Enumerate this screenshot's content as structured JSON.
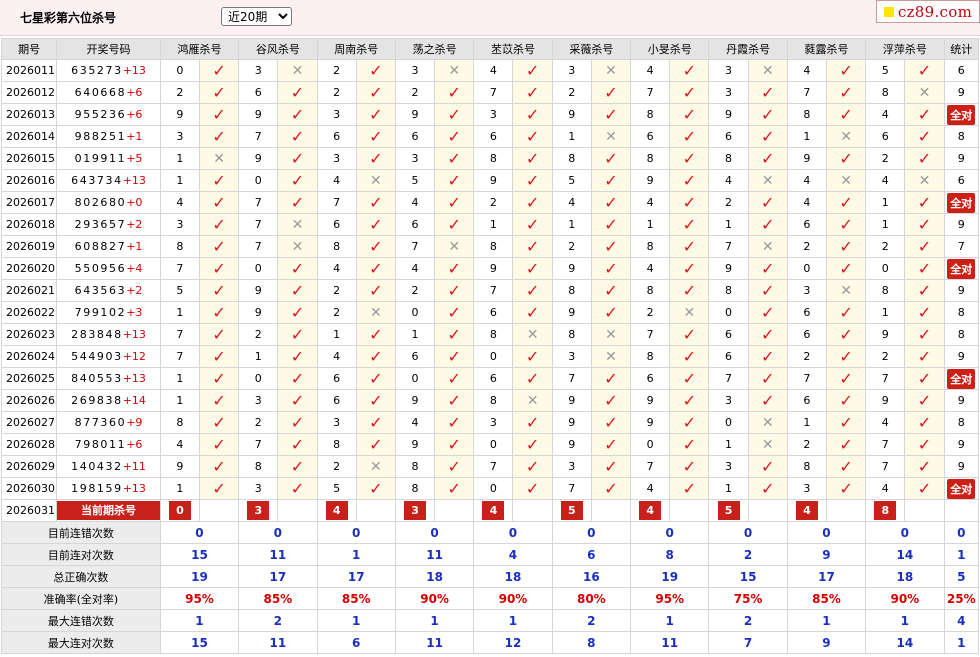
{
  "header": {
    "title": "七星彩第六位杀号",
    "period_select": "近20期",
    "logo_text": "cz89.com"
  },
  "columns": [
    "期号",
    "开奖号码",
    "鸿雁杀号",
    "谷风杀号",
    "周南杀号",
    "荡之杀号",
    "苤苡杀号",
    "采薇杀号",
    "小旻杀号",
    "丹霞杀号",
    "蕤露杀号",
    "浮萍杀号",
    "统计"
  ],
  "rows": [
    {
      "p": "2026011",
      "d": "635273",
      "x": "+13",
      "k": [
        "0",
        "3",
        "2",
        "3",
        "4",
        "3",
        "4",
        "3",
        "4",
        "5"
      ],
      "r": [
        1,
        0,
        1,
        0,
        1,
        0,
        1,
        0,
        1,
        1
      ],
      "t": "6"
    },
    {
      "p": "2026012",
      "d": "640668",
      "x": "+6",
      "k": [
        "2",
        "6",
        "2",
        "2",
        "7",
        "2",
        "7",
        "3",
        "7",
        "8"
      ],
      "r": [
        1,
        1,
        1,
        1,
        1,
        1,
        1,
        1,
        1,
        0
      ],
      "t": "9"
    },
    {
      "p": "2026013",
      "d": "955236",
      "x": "+6",
      "k": [
        "9",
        "9",
        "3",
        "9",
        "3",
        "9",
        "8",
        "9",
        "8",
        "4"
      ],
      "r": [
        1,
        1,
        1,
        1,
        1,
        1,
        1,
        1,
        1,
        1
      ],
      "t": "全对"
    },
    {
      "p": "2026014",
      "d": "988251",
      "x": "+1",
      "k": [
        "3",
        "7",
        "6",
        "6",
        "6",
        "1",
        "6",
        "6",
        "1",
        "6"
      ],
      "r": [
        1,
        1,
        1,
        1,
        1,
        0,
        1,
        1,
        0,
        1
      ],
      "t": "8"
    },
    {
      "p": "2026015",
      "d": "019911",
      "x": "+5",
      "k": [
        "1",
        "9",
        "3",
        "3",
        "8",
        "8",
        "8",
        "8",
        "9",
        "2"
      ],
      "r": [
        0,
        1,
        1,
        1,
        1,
        1,
        1,
        1,
        1,
        1
      ],
      "t": "9"
    },
    {
      "p": "2026016",
      "d": "643734",
      "x": "+13",
      "k": [
        "1",
        "0",
        "4",
        "5",
        "9",
        "5",
        "9",
        "4",
        "4",
        "4"
      ],
      "r": [
        1,
        1,
        0,
        1,
        1,
        1,
        1,
        0,
        0,
        0
      ],
      "t": "6"
    },
    {
      "p": "2026017",
      "d": "802680",
      "x": "+0",
      "k": [
        "4",
        "7",
        "7",
        "4",
        "2",
        "4",
        "4",
        "2",
        "4",
        "1"
      ],
      "r": [
        1,
        1,
        1,
        1,
        1,
        1,
        1,
        1,
        1,
        1
      ],
      "t": "全对"
    },
    {
      "p": "2026018",
      "d": "293657",
      "x": "+2",
      "k": [
        "3",
        "7",
        "6",
        "6",
        "1",
        "1",
        "1",
        "1",
        "6",
        "1"
      ],
      "r": [
        1,
        0,
        1,
        1,
        1,
        1,
        1,
        1,
        1,
        1
      ],
      "t": "9"
    },
    {
      "p": "2026019",
      "d": "608827",
      "x": "+1",
      "k": [
        "8",
        "7",
        "8",
        "7",
        "8",
        "2",
        "8",
        "7",
        "2",
        "2"
      ],
      "r": [
        1,
        0,
        1,
        0,
        1,
        1,
        1,
        0,
        1,
        1
      ],
      "t": "7"
    },
    {
      "p": "2026020",
      "d": "550956",
      "x": "+4",
      "k": [
        "7",
        "0",
        "4",
        "4",
        "9",
        "9",
        "4",
        "9",
        "0",
        "0"
      ],
      "r": [
        1,
        1,
        1,
        1,
        1,
        1,
        1,
        1,
        1,
        1
      ],
      "t": "全对"
    },
    {
      "p": "2026021",
      "d": "643563",
      "x": "+2",
      "k": [
        "5",
        "9",
        "2",
        "2",
        "7",
        "8",
        "8",
        "8",
        "3",
        "8"
      ],
      "r": [
        1,
        1,
        1,
        1,
        1,
        1,
        1,
        1,
        0,
        1
      ],
      "t": "9"
    },
    {
      "p": "2026022",
      "d": "799102",
      "x": "+3",
      "k": [
        "1",
        "9",
        "2",
        "0",
        "6",
        "9",
        "2",
        "0",
        "6",
        "1"
      ],
      "r": [
        1,
        1,
        0,
        1,
        1,
        1,
        0,
        1,
        1,
        1
      ],
      "t": "8"
    },
    {
      "p": "2026023",
      "d": "283848",
      "x": "+13",
      "k": [
        "7",
        "2",
        "1",
        "1",
        "8",
        "8",
        "7",
        "6",
        "6",
        "9"
      ],
      "r": [
        1,
        1,
        1,
        1,
        0,
        0,
        1,
        1,
        1,
        1
      ],
      "t": "8"
    },
    {
      "p": "2026024",
      "d": "544903",
      "x": "+12",
      "k": [
        "7",
        "1",
        "4",
        "6",
        "0",
        "3",
        "8",
        "6",
        "2",
        "2"
      ],
      "r": [
        1,
        1,
        1,
        1,
        1,
        0,
        1,
        1,
        1,
        1
      ],
      "t": "9"
    },
    {
      "p": "2026025",
      "d": "840553",
      "x": "+13",
      "k": [
        "1",
        "0",
        "6",
        "0",
        "6",
        "7",
        "6",
        "7",
        "7",
        "7"
      ],
      "r": [
        1,
        1,
        1,
        1,
        1,
        1,
        1,
        1,
        1,
        1
      ],
      "t": "全对"
    },
    {
      "p": "2026026",
      "d": "269838",
      "x": "+14",
      "k": [
        "1",
        "3",
        "6",
        "9",
        "8",
        "9",
        "9",
        "3",
        "6",
        "9"
      ],
      "r": [
        1,
        1,
        1,
        1,
        0,
        1,
        1,
        1,
        1,
        1
      ],
      "t": "9"
    },
    {
      "p": "2026027",
      "d": "877360",
      "x": "+9",
      "k": [
        "8",
        "2",
        "3",
        "4",
        "3",
        "9",
        "9",
        "0",
        "1",
        "4"
      ],
      "r": [
        1,
        1,
        1,
        1,
        1,
        1,
        1,
        0,
        1,
        1
      ],
      "t": "8"
    },
    {
      "p": "2026028",
      "d": "798011",
      "x": "+6",
      "k": [
        "4",
        "7",
        "8",
        "9",
        "0",
        "9",
        "0",
        "1",
        "2",
        "7"
      ],
      "r": [
        1,
        1,
        1,
        1,
        1,
        1,
        1,
        0,
        1,
        1
      ],
      "t": "9"
    },
    {
      "p": "2026029",
      "d": "140432",
      "x": "+11",
      "k": [
        "9",
        "8",
        "2",
        "8",
        "7",
        "3",
        "7",
        "3",
        "8",
        "7"
      ],
      "r": [
        1,
        1,
        0,
        1,
        1,
        1,
        1,
        1,
        1,
        1
      ],
      "t": "9"
    },
    {
      "p": "2026030",
      "d": "198159",
      "x": "+13",
      "k": [
        "1",
        "3",
        "5",
        "8",
        "0",
        "7",
        "4",
        "1",
        "3",
        "4"
      ],
      "r": [
        1,
        1,
        1,
        1,
        1,
        1,
        1,
        1,
        1,
        1
      ],
      "t": "全对"
    }
  ],
  "current": {
    "period": "2026031",
    "label": "当前期杀号",
    "kills": [
      "0",
      "3",
      "4",
      "3",
      "4",
      "5",
      "4",
      "5",
      "4",
      "8"
    ]
  },
  "stats": [
    {
      "label": "目前连错次数",
      "vals": [
        "0",
        "0",
        "0",
        "0",
        "0",
        "0",
        "0",
        "0",
        "0",
        "0",
        "0"
      ]
    },
    {
      "label": "目前连对次数",
      "vals": [
        "15",
        "11",
        "1",
        "11",
        "4",
        "6",
        "8",
        "2",
        "9",
        "14",
        "1"
      ]
    },
    {
      "label": "总正确次数",
      "vals": [
        "19",
        "17",
        "17",
        "18",
        "18",
        "16",
        "19",
        "15",
        "17",
        "18",
        "5"
      ]
    },
    {
      "label": "准确率(全对率)",
      "vals": [
        "95%",
        "85%",
        "85%",
        "90%",
        "90%",
        "80%",
        "95%",
        "75%",
        "85%",
        "90%",
        "25%"
      ],
      "rate": true
    },
    {
      "label": "最大连错次数",
      "vals": [
        "1",
        "2",
        "1",
        "1",
        "1",
        "2",
        "1",
        "2",
        "1",
        "1",
        "4"
      ]
    },
    {
      "label": "最大连对次数",
      "vals": [
        "15",
        "11",
        "6",
        "11",
        "12",
        "8",
        "11",
        "7",
        "9",
        "14",
        "1"
      ]
    }
  ],
  "marks": {
    "correct": "✓",
    "wrong": "✕"
  },
  "colors": {
    "tick": "#e0141e",
    "badge": "#cc2016",
    "stat_blue": "#1a2fbf",
    "stat_red": "#d40000"
  }
}
